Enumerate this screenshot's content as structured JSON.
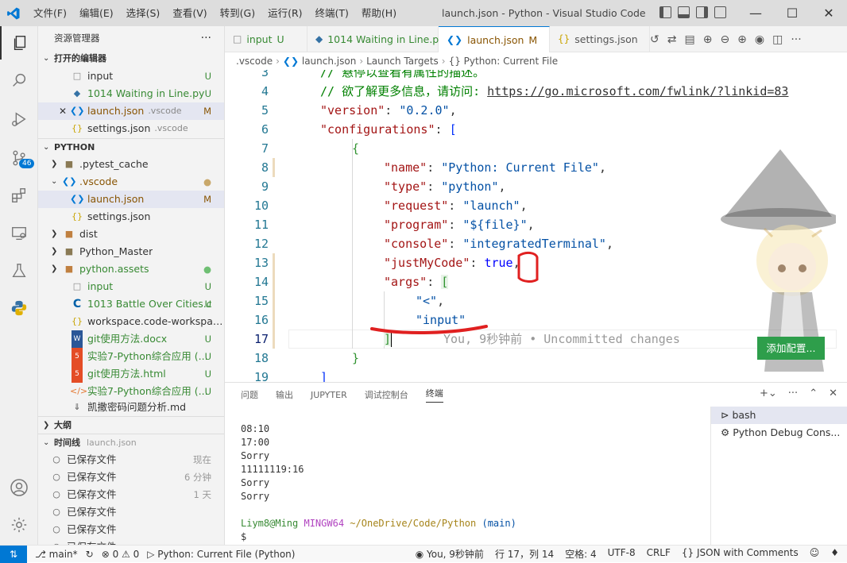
{
  "titlebar": {
    "menus": [
      "文件(F)",
      "编辑(E)",
      "选择(S)",
      "查看(V)",
      "转到(G)",
      "运行(R)",
      "终端(T)",
      "帮助(H)"
    ],
    "title": "launch.json - Python - Visual Studio Code"
  },
  "activity": {
    "scm_badge": "46"
  },
  "sidebar": {
    "title": "资源管理器",
    "more": "···",
    "open_editors": {
      "label": "打开的编辑器",
      "items": [
        {
          "name": "input",
          "status": "U",
          "icon": "file-icon"
        },
        {
          "name": "1014 Waiting in Line.py",
          "status": "U",
          "icon": "python-icon"
        },
        {
          "name": "launch.json",
          "dir": ".vscode",
          "status": "M",
          "icon": "vscode-icon"
        },
        {
          "name": "settings.json",
          "dir": ".vscode",
          "status": "",
          "icon": "json-icon"
        }
      ]
    },
    "project": {
      "label": "PYTHON",
      "items": [
        {
          "name": ".pytest_cache",
          "status": "",
          "icon": "folder"
        },
        {
          "name": ".vscode",
          "status": "●",
          "icon": "vscode-folder"
        },
        {
          "name": "launch.json",
          "status": "M",
          "icon": "vscode"
        },
        {
          "name": "settings.json",
          "status": "",
          "icon": "json"
        },
        {
          "name": "dist",
          "status": "",
          "icon": "folder"
        },
        {
          "name": "Python_Master",
          "status": "",
          "icon": "folder"
        },
        {
          "name": "python.assets",
          "status": "●",
          "icon": "folder"
        },
        {
          "name": "input",
          "status": "U",
          "icon": "file"
        },
        {
          "name": "1013 Battle Over Cities.c",
          "status": "U",
          "icon": "c"
        },
        {
          "name": "workspace.code-workspace",
          "status": "",
          "icon": "json"
        },
        {
          "name": "git使用方法.docx",
          "status": "U",
          "icon": "word"
        },
        {
          "name": "实验7-Python综合应用 (...",
          "status": "U",
          "icon": "html"
        },
        {
          "name": "git使用方法.html",
          "status": "U",
          "icon": "html"
        },
        {
          "name": "实验7-Python综合应用 (...",
          "status": "U",
          "icon": "xml"
        },
        {
          "name": "凯撒密码问题分析.md",
          "status": "",
          "icon": "md"
        }
      ]
    },
    "outline_label": "大纲",
    "timeline": {
      "label": "时间线",
      "file": "launch.json",
      "items": [
        {
          "name": "已保存文件",
          "time": "现在"
        },
        {
          "name": "已保存文件",
          "time": "6 分钟"
        },
        {
          "name": "已保存文件",
          "time": "1 天"
        },
        {
          "name": "已保存文件",
          "time": ""
        },
        {
          "name": "已保存文件",
          "time": ""
        },
        {
          "name": "已保存文件",
          "time": ""
        }
      ]
    }
  },
  "tabs": [
    {
      "name": "input",
      "status": "U",
      "icon": "file"
    },
    {
      "name": "1014 Waiting in Line.py",
      "status": "",
      "icon": "python"
    },
    {
      "name": "launch.json",
      "status": "M",
      "icon": "vscode",
      "active": true
    },
    {
      "name": "settings.json",
      "status": "",
      "icon": "json"
    }
  ],
  "breadcrumb": [
    ".vscode",
    "launch.json",
    "Launch Targets",
    "{} Python: Current File"
  ],
  "code": {
    "line_numbers": [
      "3",
      "4",
      "5",
      "6",
      "7",
      "8",
      "9",
      "10",
      "11",
      "12",
      "13",
      "14",
      "15",
      "16",
      "17",
      "18",
      "19"
    ],
    "line3": "// 悬停以查看有属性的描述。",
    "line4_comment": "// 欲了解更多信息，请访问: ",
    "line4_url": "https://go.microsoft.com/fwlink/?linkid=83",
    "version_key": "\"version\"",
    "version_val": "\"0.2.0\"",
    "configurations_key": "\"configurations\"",
    "name_key": "\"name\"",
    "name_val": "\"Python: Current File\"",
    "type_key": "\"type\"",
    "type_val": "\"python\"",
    "request_key": "\"request\"",
    "request_val": "\"launch\"",
    "program_key": "\"program\"",
    "program_val": "\"${file}\"",
    "console_key": "\"console\"",
    "console_val": "\"integratedTerminal\"",
    "justmycode_key": "\"justMyCode\"",
    "justmycode_val": "true",
    "args_key": "\"args\"",
    "arg1": "\"<\"",
    "arg2": "\"input\"",
    "ghost_text": "You, 9秒钟前 • Uncommitted changes"
  },
  "add_config_button": "添加配置...",
  "panel": {
    "tabs": [
      "问题",
      "输出",
      "JUPYTER",
      "调试控制台",
      "终端"
    ],
    "terminal_lines": [
      "08:10",
      "17:00",
      "Sorry",
      "11111119:16",
      "Sorry",
      "Sorry"
    ],
    "prompt_user": "Liym8@Ming",
    "prompt_host": "MINGW64",
    "prompt_path": "~/OneDrive/Code/Python",
    "prompt_branch": "(main)",
    "prompt_symbol": "$",
    "terminals": [
      "bash",
      "Python Debug Cons..."
    ]
  },
  "statusbar": {
    "branch": "main*",
    "problems": "⊗ 0 ⚠ 0",
    "debug_target": "Python: Current File (Python)",
    "blame": "You, 9秒钟前",
    "position": "行 17，列 14",
    "indent": "空格: 4",
    "encoding": "UTF-8",
    "eol": "CRLF",
    "language": "JSON with Comments"
  }
}
